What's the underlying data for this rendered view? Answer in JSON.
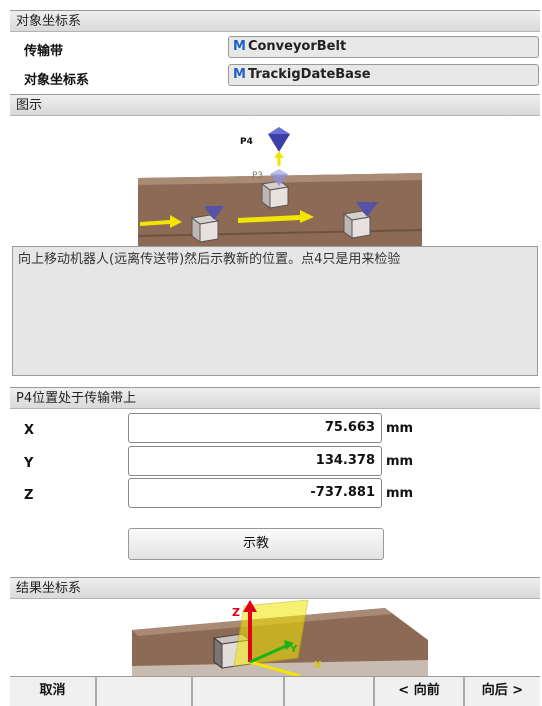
{
  "object_frame": {
    "header": "对象坐标系",
    "rows": [
      {
        "label": "传输带",
        "prefix": "M",
        "value": "ConveyorBelt"
      },
      {
        "label": "对象坐标系",
        "prefix": "M",
        "value": "TrackigDateBase"
      }
    ]
  },
  "illustration": {
    "header": "图示",
    "labels": {
      "p4": "P4",
      "p3": "P3"
    },
    "instruction": "向上移动机器人(远离传送带)然后示教新的位置。点4只是用来检验"
  },
  "position": {
    "header": "P4位置处于传输带上",
    "fields": [
      {
        "axis": "X",
        "value": "75.663",
        "unit": "mm"
      },
      {
        "axis": "Y",
        "value": "134.378",
        "unit": "mm"
      },
      {
        "axis": "Z",
        "value": "-737.881",
        "unit": "mm"
      }
    ],
    "teach_label": "示教"
  },
  "result_frame": {
    "header": "结果坐标系",
    "axis_labels": {
      "z": "Z",
      "y": "Y",
      "x": "X"
    }
  },
  "footer": {
    "cancel": "取消",
    "back": "< 向前",
    "next": "向后 >"
  },
  "colors": {
    "accent_blue": "#1e5fc9",
    "arrow_yellow": "#f2e600",
    "conveyor_brown": "#8c6a55",
    "axis_red": "#e2001a",
    "axis_green": "#18b318"
  }
}
